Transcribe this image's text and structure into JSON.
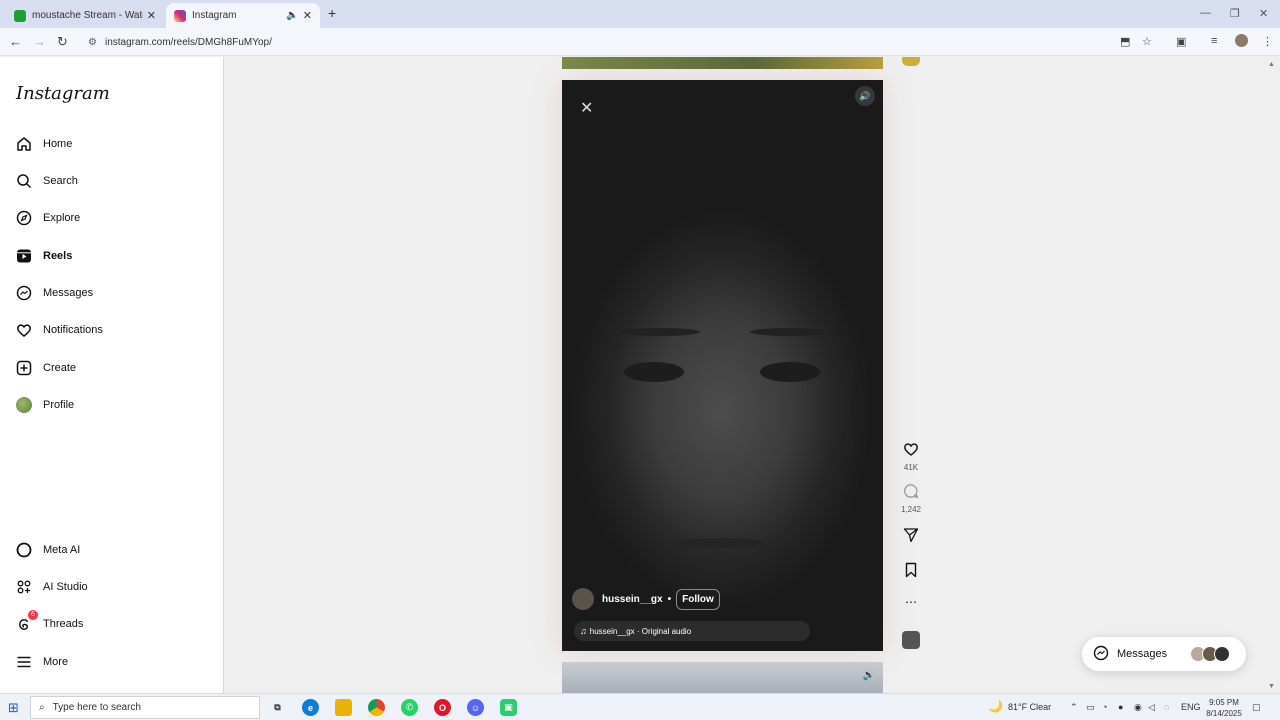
{
  "browser": {
    "tabs": [
      {
        "title": "moustache Stream - Watch Live",
        "active": false,
        "favicon_color": "#1c9f3a"
      },
      {
        "title": "Instagram",
        "active": true,
        "favicon_color": "#d6249f"
      }
    ],
    "url": "instagram.com/reels/DMGh8FuMYop/"
  },
  "sidebar": {
    "logo": "Instagram",
    "items": [
      {
        "label": "Home",
        "icon": "home-icon"
      },
      {
        "label": "Search",
        "icon": "search-icon"
      },
      {
        "label": "Explore",
        "icon": "compass-icon"
      },
      {
        "label": "Reels",
        "icon": "reels-icon",
        "active": true
      },
      {
        "label": "Messages",
        "icon": "messenger-icon"
      },
      {
        "label": "Notifications",
        "icon": "heart-icon"
      },
      {
        "label": "Create",
        "icon": "plus-square-icon"
      },
      {
        "label": "Profile",
        "icon": "profile-avatar"
      }
    ],
    "bottom_items": [
      {
        "label": "Meta AI",
        "icon": "meta-ai-icon"
      },
      {
        "label": "AI Studio",
        "icon": "ai-studio-icon"
      },
      {
        "label": "Threads",
        "icon": "threads-icon",
        "badge": "6"
      },
      {
        "label": "More",
        "icon": "menu-icon"
      }
    ]
  },
  "reel": {
    "username": "hussein__gx",
    "follow_label": "Follow",
    "audio": "hussein__gx · Original audio",
    "likes": "41K",
    "comments": "1,242"
  },
  "messages_pill": {
    "label": "Messages"
  },
  "taskbar": {
    "search_placeholder": "Type here to search",
    "weather": "81°F  Clear",
    "lang": "ENG",
    "time": "9:05 PM",
    "date": "8/14/2025"
  }
}
